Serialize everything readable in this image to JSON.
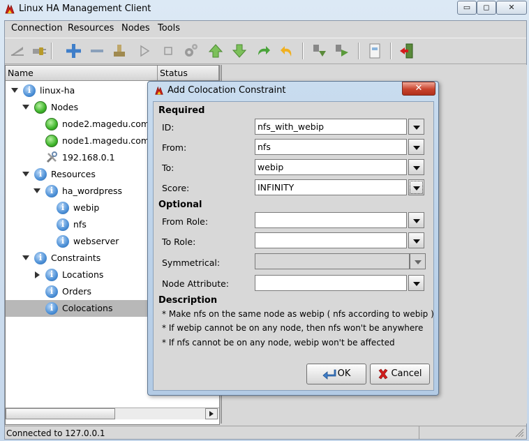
{
  "window": {
    "title": "Linux HA Management Client",
    "controls": {
      "minimize": "▭",
      "maximize": "◻",
      "close": "✕"
    }
  },
  "menubar": [
    "Connection",
    "Resources",
    "Nodes",
    "Tools"
  ],
  "toolbar": {
    "icons": [
      "connect-icon",
      "disconnect-icon",
      "add-icon",
      "remove-icon",
      "cleanup-icon",
      "start-icon",
      "stop-icon",
      "default-action-icon",
      "move-up-icon",
      "move-down-icon",
      "redo-icon",
      "undo-icon",
      "make-standby-icon",
      "make-active-icon",
      "view-xml-icon",
      "exit-icon"
    ]
  },
  "tree": {
    "columns": {
      "name": "Name",
      "status": "Status"
    },
    "items": [
      {
        "label": "linux-ha",
        "level": 0,
        "icon": "info",
        "toggle": "open"
      },
      {
        "label": "Nodes",
        "level": 1,
        "icon": "green",
        "toggle": "open"
      },
      {
        "label": "node2.magedu.com",
        "level": 2,
        "icon": "green",
        "toggle": ""
      },
      {
        "label": "node1.magedu.com",
        "level": 2,
        "icon": "green",
        "toggle": ""
      },
      {
        "label": "192.168.0.1",
        "level": 2,
        "icon": "tools",
        "toggle": ""
      },
      {
        "label": "Resources",
        "level": 1,
        "icon": "info",
        "toggle": "open"
      },
      {
        "label": "ha_wordpress",
        "level": 2,
        "icon": "info",
        "toggle": "open"
      },
      {
        "label": "webip",
        "level": 3,
        "icon": "info",
        "toggle": ""
      },
      {
        "label": "nfs",
        "level": 3,
        "icon": "info",
        "toggle": ""
      },
      {
        "label": "webserver",
        "level": 3,
        "icon": "info",
        "toggle": ""
      },
      {
        "label": "Constraints",
        "level": 1,
        "icon": "info",
        "toggle": "open"
      },
      {
        "label": "Locations",
        "level": 2,
        "icon": "info",
        "toggle": "closed"
      },
      {
        "label": "Orders",
        "level": 2,
        "icon": "info",
        "toggle": ""
      },
      {
        "label": "Colocations",
        "level": 2,
        "icon": "info",
        "toggle": "",
        "selected": true
      }
    ]
  },
  "status": {
    "text": "Connected to 127.0.0.1"
  },
  "dialog": {
    "title": "Add Colocation Constraint",
    "close": "✕",
    "required_label": "Required",
    "optional_label": "Optional",
    "description_label": "Description",
    "fields": {
      "id": {
        "label": "ID:",
        "value": "nfs_with_webip"
      },
      "from": {
        "label": "From:",
        "value": "nfs"
      },
      "to": {
        "label": "To:",
        "value": "webip"
      },
      "score": {
        "label": "Score:",
        "value": "INFINITY"
      },
      "from_role": {
        "label": "From Role:",
        "value": ""
      },
      "to_role": {
        "label": "To Role:",
        "value": ""
      },
      "symmetrical": {
        "label": "Symmetrical:",
        "value": ""
      },
      "node_attribute": {
        "label": "Node Attribute:",
        "value": ""
      }
    },
    "description": [
      "* Make nfs  on the same node as webip   ( nfs according to webip )",
      "* If webip cannot be  on any node, then nfs won't be  anywhere",
      "* If nfs cannot be  on any node, webip won't be affected"
    ],
    "ok_label": "OK",
    "cancel_label": "Cancel"
  },
  "colors": {
    "selection": "#b8b8b8",
    "close_button": "#c8432d",
    "titlebar": "#c4d6ea"
  }
}
